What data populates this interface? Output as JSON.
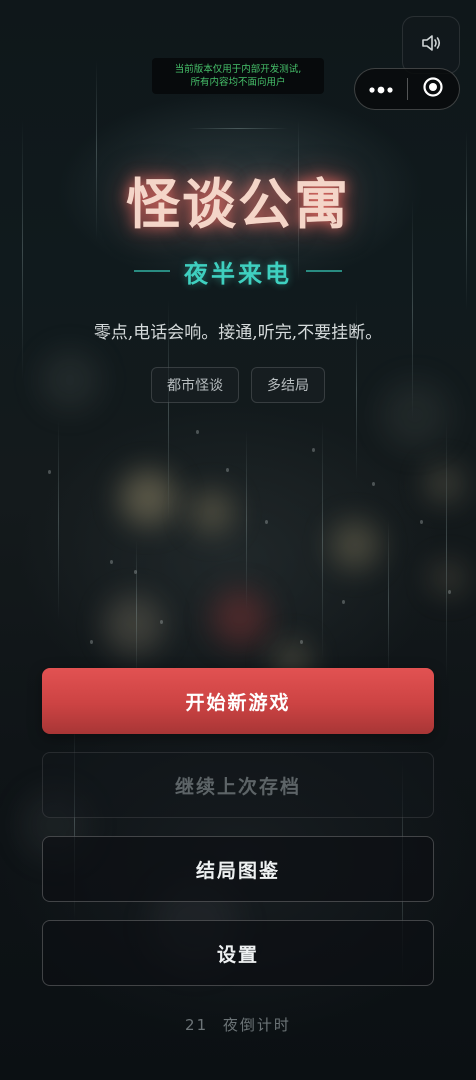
{
  "top_bar": {
    "dev_notice_line1": "当前版本仅用于内部开发测试,",
    "dev_notice_line2": "所有内容均不面向用户",
    "sound_icon": "speaker-icon",
    "more_icon": "more-dots-icon",
    "close_icon": "target-circle-icon"
  },
  "hero": {
    "title": "怪谈公寓",
    "subtitle": "夜半来电",
    "tagline": "零点,电话会响。接通,听完,不要挂断。",
    "tags": [
      "都市怪谈",
      "多结局"
    ]
  },
  "menu": {
    "start_label": "开始新游戏",
    "continue_label": "继续上次存档",
    "endings_label": "结局图鉴",
    "settings_label": "设置"
  },
  "footer": {
    "countdown_number": "21",
    "countdown_label": "夜倒计时"
  },
  "colors": {
    "accent_red": "#d94a4a",
    "title_glow": "#ff7a6e",
    "subtitle_teal": "#3fd0c0",
    "notice_green": "#46c06a"
  }
}
